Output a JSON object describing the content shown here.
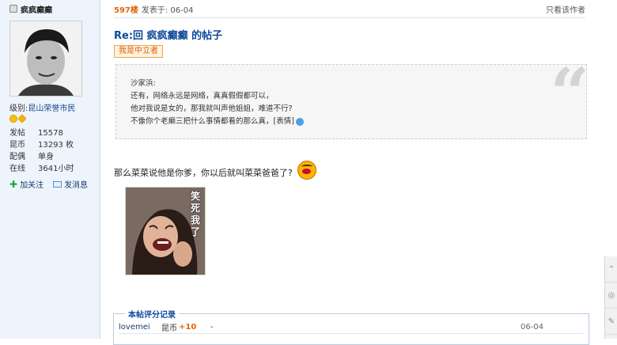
{
  "user": {
    "name": "疯疯癫癫",
    "level_prefix": "级别:",
    "level": "昆山荣誉市民",
    "stats": [
      {
        "key": "发帖",
        "value": "15578"
      },
      {
        "key": "昆币",
        "value": "13293 枚"
      },
      {
        "key": "配偶",
        "value": "单身"
      },
      {
        "key": "在线",
        "value": "3641小时"
      }
    ],
    "follow_label": "加关注",
    "message_label": "发消息"
  },
  "post": {
    "floor": "597楼",
    "posted_at": "发表于: 06-04",
    "only_author": "只看该作者",
    "title": "Re:回 疯疯癫癫 的帖子",
    "badge": "我是中立者",
    "quote_lines": [
      "沙家浜:",
      "还有，网络永远是网络，真真假假都可以，",
      "他对我说是女的，那我就叫声他姐姐，难道不行?",
      "不像你个老癞三把什么事情都看的那么真，[表情]"
    ],
    "body": "那么菜菜说他是你爹，你以后就叫菜菜爸爸了?",
    "image_caption": "笑死我了"
  },
  "rating": {
    "legend": "本帖评分记录",
    "rows": [
      {
        "user": "lovemei",
        "currency": "昆币",
        "points": "+10",
        "reason": "-",
        "date": "06-04"
      }
    ]
  },
  "icons": [
    "user-icon",
    "smile-icon",
    "star-icon",
    "plus-icon",
    "envelope-icon",
    "emoji-laugh-icon",
    "quote-mark-icon",
    "expression-icon"
  ]
}
